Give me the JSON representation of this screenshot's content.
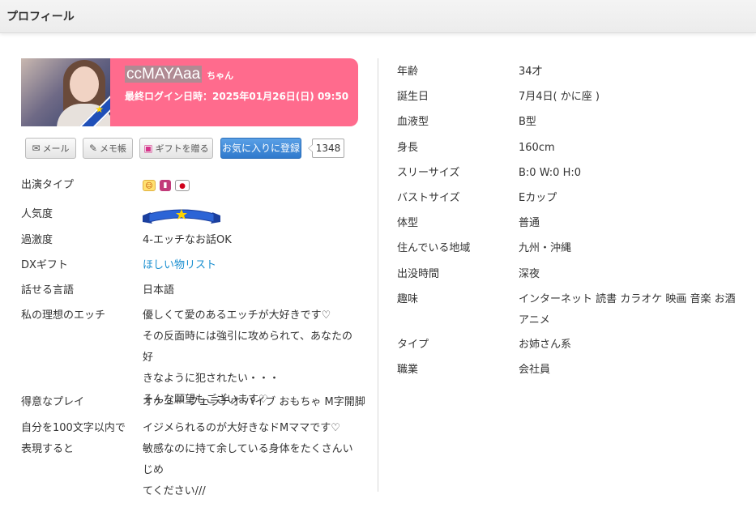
{
  "header": {
    "title": "プロフィール"
  },
  "profile": {
    "name": "ccMAYAaa",
    "suffix": "ちゃん",
    "last_login": "最終ログイン日時：2025年01月26日(日) 09:50"
  },
  "actions": {
    "mail": "メール",
    "memo": "メモ帳",
    "gift": "ギフトを贈る",
    "favorite": "お気に入りに登録",
    "favorite_count": "1348"
  },
  "icons": {
    "mail": "envelope-icon",
    "memo": "pencil-note-icon",
    "gift": "gift-icon",
    "rank": "star-ribbon-icon"
  },
  "colors": {
    "accent": "#ff6b8d",
    "favorite": "#3a86d6",
    "link": "#1a8fd0"
  },
  "left_details": {
    "appearance_type": {
      "label": "出演タイプ"
    },
    "popularity": {
      "label": "人気度"
    },
    "intensity": {
      "label": "過激度",
      "value": "4-エッチなお話OK"
    },
    "dx_gift": {
      "label": "DXギフト",
      "value": "ほしい物リスト"
    },
    "language": {
      "label": "話せる言語",
      "value": "日本語"
    },
    "ideal": {
      "label": "私の理想のエッチ",
      "lines": [
        "優しくて愛のあるエッチが大好きです♡",
        "その反面時には強引に攻められて、あなたの好",
        "きなように犯されたい・・・",
        "そんな願望もございます♡"
      ]
    },
    "play": {
      "label": "得意なプレイ",
      "value": "オナニー フェラチオ バイブ おもちゃ M字開脚"
    },
    "self_intro": {
      "label_lines": [
        "自分を100文字以内で",
        "表現すると"
      ],
      "lines": [
        "イジメられるのが大好きなドMママです♡",
        "敏感なのに持て余している身体をたくさんいじめ",
        "てください///"
      ]
    }
  },
  "right_details": [
    {
      "label": "年齢",
      "value": "34才"
    },
    {
      "label": "誕生日",
      "value": "7月4日( かに座 )"
    },
    {
      "label": "血液型",
      "value": "B型"
    },
    {
      "label": "身長",
      "value": "160cm"
    },
    {
      "label": "スリーサイズ",
      "value": "B:0 W:0 H:0"
    },
    {
      "label": "バストサイズ",
      "value": "Eカップ"
    },
    {
      "label": "体型",
      "value": "普通"
    },
    {
      "label": "住んでいる地域",
      "value": "九州・沖縄"
    },
    {
      "label": "出没時間",
      "value": "深夜"
    },
    {
      "label": "趣味",
      "value_lines": [
        "インターネット 読書 カラオケ 映画 音楽 お酒",
        "アニメ"
      ]
    },
    {
      "label": "タイプ",
      "value": "お姉さん系"
    },
    {
      "label": "職業",
      "value": "会社員"
    }
  ]
}
